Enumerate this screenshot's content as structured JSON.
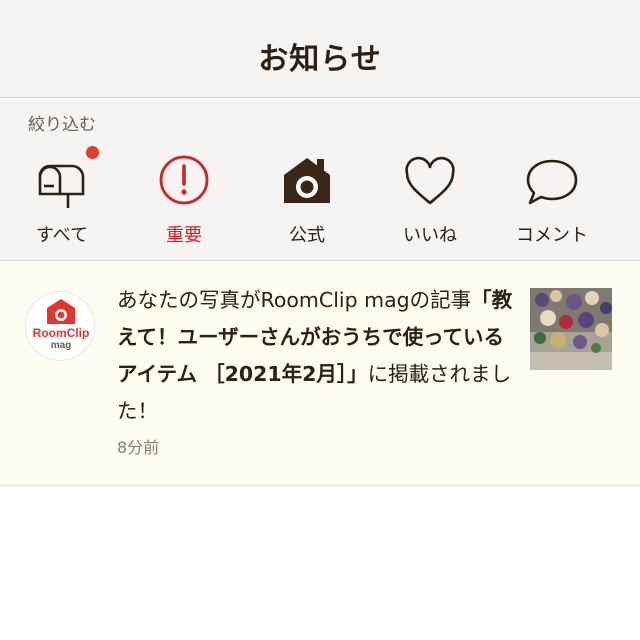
{
  "header": {
    "title": "お知らせ"
  },
  "filter": {
    "label": "絞り込む",
    "items": [
      {
        "label": "すべて",
        "icon": "mailbox-icon",
        "has_badge": true
      },
      {
        "label": "重要",
        "icon": "exclamation-circle-icon",
        "active": true
      },
      {
        "label": "公式",
        "icon": "house-camera-icon"
      },
      {
        "label": "いいね",
        "icon": "heart-icon"
      },
      {
        "label": "コメント",
        "icon": "speech-bubble-icon"
      }
    ]
  },
  "notification": {
    "avatar_text": "RoomClip",
    "avatar_subtext": "mag",
    "message_prefix": "あなたの写真がRoomClip magの記事",
    "message_title": "「教えて！ユーザーさんがおうちで使っているアイテム ［2021年2月］」",
    "message_suffix": "に掲載されました！",
    "time": "8分前"
  },
  "colors": {
    "accent_red": "#d2232a",
    "badge": "#e33a31",
    "notif_bg": "#fdfcf0",
    "header_bg": "#f5f4f2"
  }
}
